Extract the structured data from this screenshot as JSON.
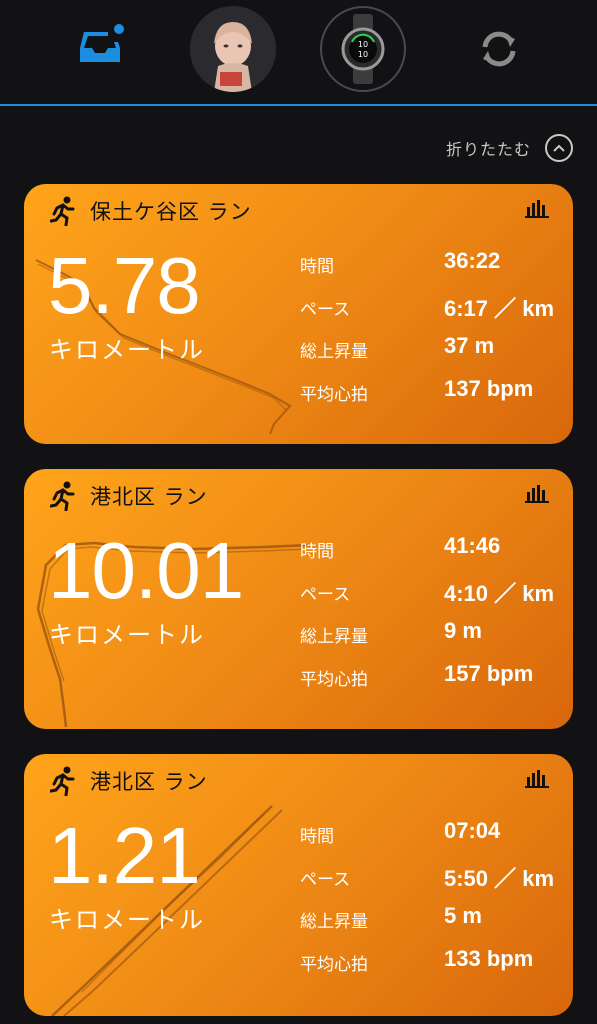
{
  "nav": {
    "items": [
      {
        "name": "inbox",
        "icon": "inbox-tray-icon",
        "badge": true
      },
      {
        "name": "profile",
        "icon": "avatar-icon"
      },
      {
        "name": "device",
        "icon": "watch-icon"
      },
      {
        "name": "sync",
        "icon": "sync-icon"
      }
    ],
    "accent": "#1b8ee0"
  },
  "collapse": {
    "label": "折りたたむ",
    "icon": "chevron-up-icon"
  },
  "colors": {
    "card_start": "#ffa41a",
    "card_end": "#d8670b",
    "background": "#121214"
  },
  "activities": [
    {
      "title": "保土ケ谷区 ラン",
      "distance": "5.78",
      "unit": "キロメートル",
      "stats": [
        {
          "label": "時間",
          "value": "36:22"
        },
        {
          "label": "ペース",
          "value": "6:17 ／ km"
        },
        {
          "label": "総上昇量",
          "value": "37 m"
        },
        {
          "label": "平均心拍",
          "value": "137 bpm"
        }
      ]
    },
    {
      "title": "港北区 ラン",
      "distance": "10.01",
      "unit": "キロメートル",
      "stats": [
        {
          "label": "時間",
          "value": "41:46"
        },
        {
          "label": "ペース",
          "value": "4:10 ／ km"
        },
        {
          "label": "総上昇量",
          "value": "9 m"
        },
        {
          "label": "平均心拍",
          "value": "157 bpm"
        }
      ]
    },
    {
      "title": "港北区 ラン",
      "distance": "1.21",
      "unit": "キロメートル",
      "stats": [
        {
          "label": "時間",
          "value": "07:04"
        },
        {
          "label": "ペース",
          "value": "5:50 ／ km"
        },
        {
          "label": "総上昇量",
          "value": "5 m"
        },
        {
          "label": "平均心拍",
          "value": "133 bpm"
        }
      ]
    }
  ]
}
